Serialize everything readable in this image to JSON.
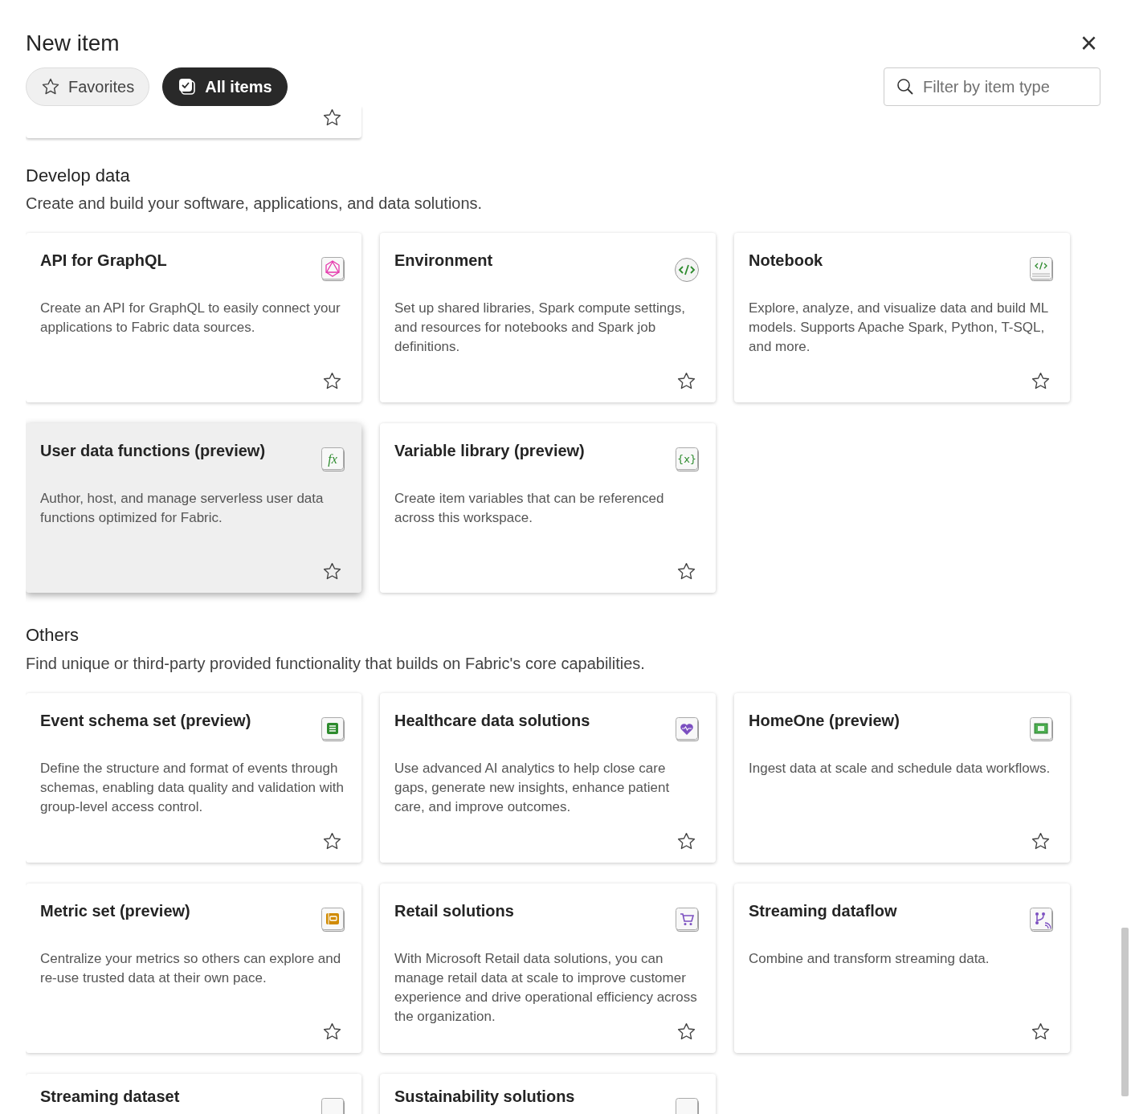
{
  "dialog": {
    "title": "New item",
    "close_label": "×"
  },
  "tabs": [
    {
      "label": "Favorites",
      "selected": false
    },
    {
      "label": "All items",
      "selected": true
    }
  ],
  "search": {
    "placeholder": "Filter by item type"
  },
  "partial_card": {
    "favorite": false
  },
  "sections": [
    {
      "title": "Develop data",
      "subtitle": "Create and build your software, applications, and data solutions.",
      "cards": [
        {
          "title": "API for GraphQL",
          "description": "Create an API for GraphQL to easily connect your applications to Fabric data sources.",
          "favorite": false,
          "highlighted": false
        },
        {
          "title": "Environment",
          "description": "Set up shared libraries, Spark compute settings, and resources for notebooks and Spark job definitions.",
          "favorite": false,
          "highlighted": false
        },
        {
          "title": "Notebook",
          "description": "Explore, analyze, and visualize data and build ML models. Supports Apache Spark, Python, T-SQL, and more.",
          "favorite": false,
          "highlighted": false
        },
        {
          "title": "User data functions (preview)",
          "icon_text": "fx",
          "description": "Author, host, and manage serverless user data functions optimized for Fabric.",
          "favorite": false,
          "highlighted": true
        },
        {
          "title": "Variable library (preview)",
          "icon_text": "{x}",
          "description": "Create item variables that can be referenced across this workspace.",
          "favorite": false,
          "highlighted": false
        }
      ]
    },
    {
      "title": "Others",
      "subtitle": "Find unique or third-party provided functionality that builds on Fabric's core capabilities.",
      "cards": [
        {
          "title": "Event schema set (preview)",
          "description": "Define the structure and format of events through schemas, enabling data quality and validation with group-level access control.",
          "favorite": false,
          "highlighted": false
        },
        {
          "title": "Healthcare data solutions",
          "description": "Use advanced AI analytics to help close care gaps, generate new insights, enhance patient care, and improve outcomes.",
          "favorite": false,
          "highlighted": false
        },
        {
          "title": "HomeOne (preview)",
          "description": "Ingest data at scale and schedule data workflows.",
          "favorite": false,
          "highlighted": false
        },
        {
          "title": "Metric set (preview)",
          "description": "Centralize your metrics so others can explore and re-use trusted data at their own pace.",
          "favorite": false,
          "highlighted": false
        },
        {
          "title": "Retail solutions",
          "description": "With Microsoft Retail data solutions, you can manage retail data at scale to improve customer experience and drive operational efficiency across the organization.",
          "favorite": false,
          "highlighted": false
        },
        {
          "title": "Streaming dataflow",
          "description": "Combine and transform streaming data.",
          "favorite": false,
          "highlighted": false
        },
        {
          "title": "Streaming dataset",
          "highlighted": false
        },
        {
          "title": "Sustainability solutions",
          "highlighted": false
        }
      ]
    }
  ]
}
